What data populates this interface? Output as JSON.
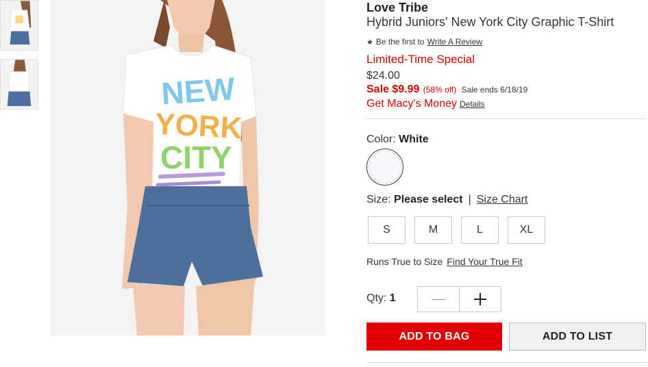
{
  "product": {
    "brand": "Love Tribe",
    "name": "Hybrid Juniors' New York City Graphic T-Shirt"
  },
  "reviews": {
    "star_icon": "star-icon",
    "text": "Be the first to",
    "link": "Write A Review"
  },
  "pricing": {
    "promo": "Limited-Time Special",
    "original": "$24.00",
    "sale_label": "Sale $9.99",
    "discount": "(58% off)",
    "sale_ends": "Sale ends 6/18/19",
    "macys_money": "Get Macy's Money",
    "details_link": "Details"
  },
  "color": {
    "label": "Color:",
    "selected": "White",
    "swatch_hex": "#f8f7f9"
  },
  "size": {
    "label": "Size:",
    "selected": "Please select",
    "separator": "|",
    "chart_link": "Size Chart",
    "options": [
      "S",
      "M",
      "L",
      "XL"
    ]
  },
  "fit": {
    "text": "Runs True to Size",
    "link": "Find Your True Fit"
  },
  "quantity": {
    "label": "Qty:",
    "value": "1"
  },
  "actions": {
    "add_to_bag": "ADD TO BAG",
    "add_to_list": "ADD TO LIST"
  },
  "colors": {
    "accent_red": "#e00000",
    "text_red": "#cc0000"
  },
  "graphic": {
    "line1": "NEW",
    "line2": "YORK",
    "line3": "CITY"
  }
}
